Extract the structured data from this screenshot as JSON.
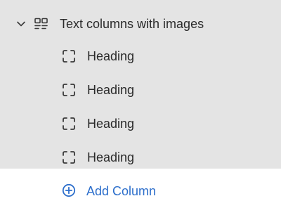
{
  "section": {
    "label": "Text columns with images",
    "icon": "columns-icon",
    "expanded": true
  },
  "blocks": [
    {
      "label": "Heading",
      "icon": "block-frame-icon"
    },
    {
      "label": "Heading",
      "icon": "block-frame-icon"
    },
    {
      "label": "Heading",
      "icon": "block-frame-icon"
    },
    {
      "label": "Heading",
      "icon": "block-frame-icon"
    }
  ],
  "add_block": {
    "label": "Add Column",
    "icon": "plus-circle-icon"
  },
  "colors": {
    "panel_background": "#e4e4e4",
    "text": "#2b2b2b",
    "accent": "#2c6ecb",
    "add_row_background": "#ffffff"
  }
}
